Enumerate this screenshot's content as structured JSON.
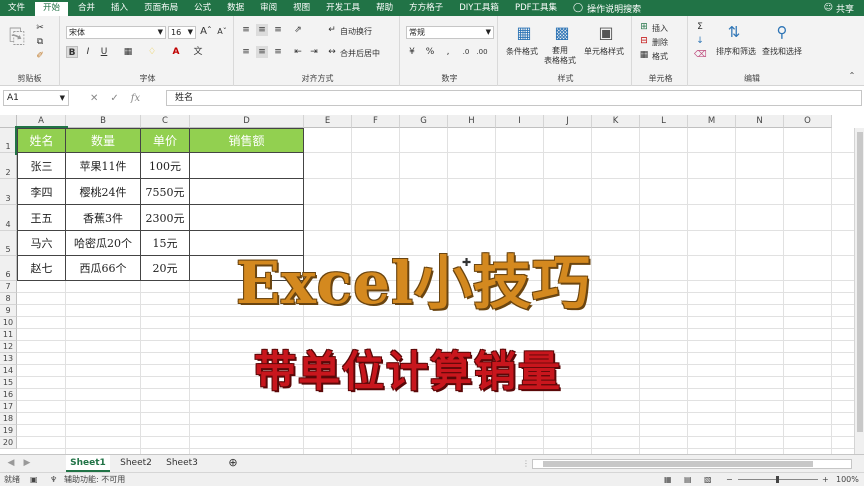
{
  "menu": {
    "tabs": [
      "文件",
      "开始",
      "合并",
      "插入",
      "页面布局",
      "公式",
      "数据",
      "审阅",
      "视图",
      "开发工具",
      "帮助",
      "方方格子",
      "DIY工具箱",
      "PDF工具集"
    ],
    "active_tab": "开始",
    "help_search": "操作说明搜索",
    "share": "共享"
  },
  "ribbon": {
    "clipboard": {
      "label": "剪贴板"
    },
    "font": {
      "label": "字体",
      "font_name": "宋体",
      "font_size": "16",
      "bold": "B",
      "italic": "I",
      "underline": "U"
    },
    "alignment": {
      "label": "对齐方式",
      "wrap_text": "自动换行",
      "merge_center": "合并后居中"
    },
    "number": {
      "label": "数字",
      "format": "常规"
    },
    "styles": {
      "label": "样式",
      "conditional": "条件格式",
      "table": "套用\n表格格式",
      "cell_styles": "单元格样式"
    },
    "cells": {
      "label": "单元格",
      "insert": "插入",
      "delete": "删除",
      "format": "格式"
    },
    "editing": {
      "label": "编辑",
      "sort_filter": "排序和筛选",
      "find_select": "查找和选择"
    }
  },
  "formula_bar": {
    "name_box": "A1",
    "formula": "姓名"
  },
  "columns": [
    "A",
    "B",
    "C",
    "D",
    "E",
    "F",
    "G",
    "H",
    "I",
    "J",
    "K",
    "L",
    "M",
    "N",
    "O"
  ],
  "rows": [
    "1",
    "2",
    "3",
    "4",
    "5",
    "6",
    "7",
    "8",
    "9",
    "10",
    "11",
    "12",
    "13",
    "14",
    "15",
    "16",
    "17",
    "18",
    "19",
    "20"
  ],
  "table": {
    "headers": [
      "姓名",
      "数量",
      "单价",
      "销售额"
    ],
    "rows": [
      [
        "张三",
        "苹果11件",
        "100元",
        ""
      ],
      [
        "李四",
        "樱桃24件",
        "7550元",
        ""
      ],
      [
        "王五",
        "香蕉3件",
        "2300元",
        ""
      ],
      [
        "马六",
        "哈密瓜20个",
        "15元",
        ""
      ],
      [
        "赵七",
        "西瓜66个",
        "20元",
        ""
      ]
    ],
    "header_color": "#92d050"
  },
  "overlay": {
    "title": "Excel小技巧",
    "subtitle": "带单位计算销量",
    "title_color": "#d4891f",
    "subtitle_color": "#c8161d"
  },
  "sheets": [
    "Sheet1",
    "Sheet2",
    "Sheet3"
  ],
  "active_sheet": "Sheet1",
  "status": {
    "ready": "就绪",
    "accessibility": "辅助功能: 不可用",
    "zoom": "100%"
  },
  "accent_color": "#217346"
}
